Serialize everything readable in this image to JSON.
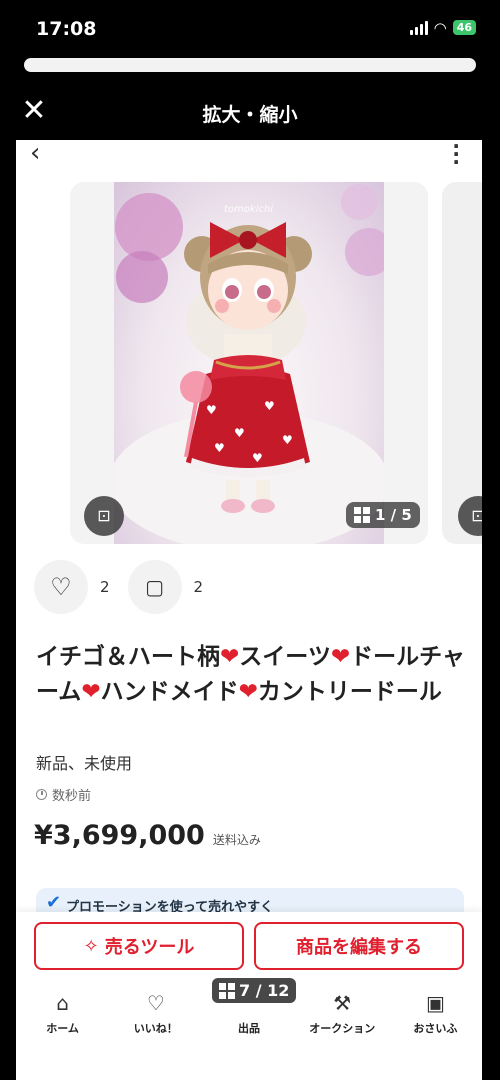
{
  "status_bar": {
    "time": "17:08",
    "battery": "46"
  },
  "modal": {
    "title": "拡大・縮小"
  },
  "gallery": {
    "counter": "1 / 5",
    "watermark": "tomokichi"
  },
  "engagement": {
    "likes": "2",
    "comments": "2"
  },
  "item": {
    "title_parts": [
      "イチゴ＆ハート柄",
      "スイーツ",
      "ドールチャーム",
      "ハンドメイド",
      "カントリードール"
    ],
    "heart_glyph": "❤",
    "condition": "新品、未使用",
    "posted": "数秒前",
    "price": "¥3,699,000",
    "price_note": "送料込み"
  },
  "banner": {
    "text": "プロモーションを使って売れやすく"
  },
  "actions": {
    "tools_label": "売るツール",
    "edit_label": "商品を編集する"
  },
  "tabbar": {
    "home": "ホーム",
    "likes": "いいね！",
    "sell": "出品",
    "auction": "オークション",
    "wallet": "おさいふ"
  },
  "pager": {
    "label": "7 / 12"
  },
  "colors": {
    "accent": "#e0202e",
    "background": "#ffffff"
  }
}
